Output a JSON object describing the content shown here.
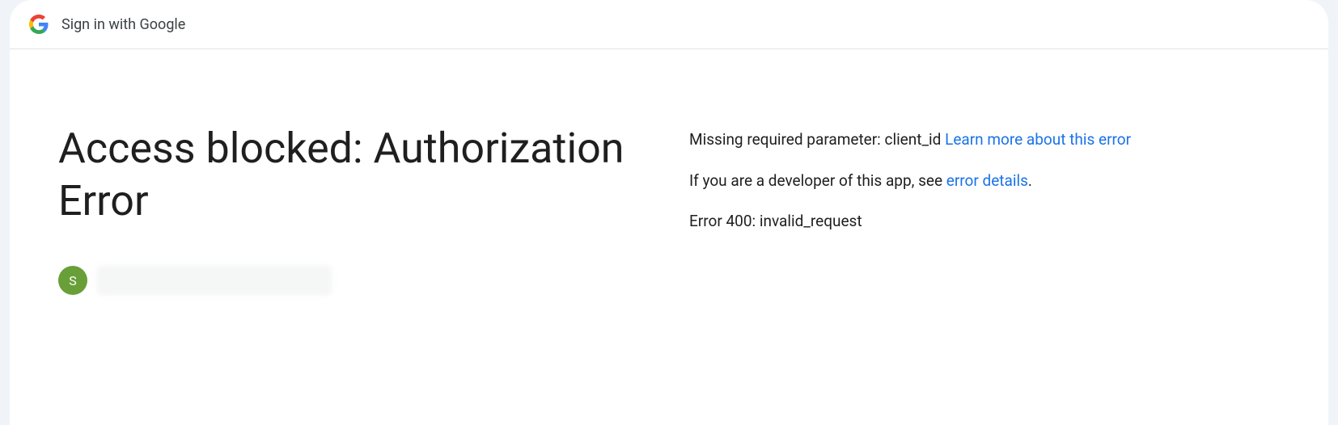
{
  "header": {
    "title": "Sign in with Google"
  },
  "main": {
    "title": "Access blocked: Authorization Error"
  },
  "account": {
    "avatar_letter": "S"
  },
  "details": {
    "line1_text": "Missing required parameter: client_id ",
    "line1_link": "Learn more about this error",
    "line2_text_before": "If you are a developer of this app, see ",
    "line2_link": "error details",
    "line2_text_after": ".",
    "line3_text": "Error 400: invalid_request"
  },
  "colors": {
    "link": "#1a73e8",
    "avatar_bg": "#689f38"
  }
}
